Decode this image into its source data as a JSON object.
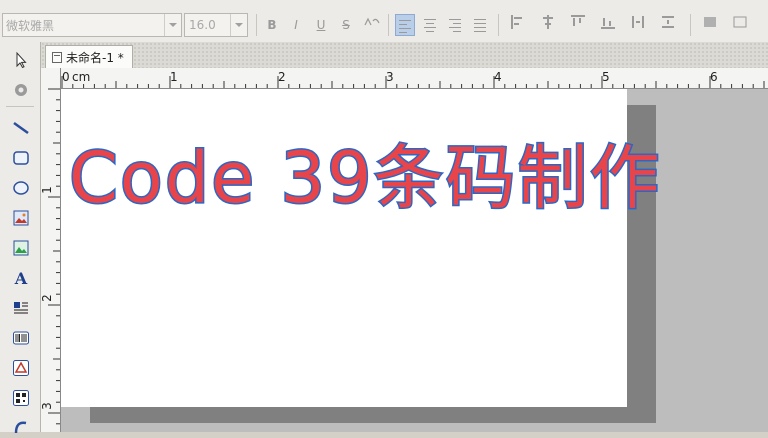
{
  "toolbar": {
    "font_name": "微软雅黑",
    "font_size": "16.0",
    "bold_label": "B",
    "italic_label": "I",
    "underline_label": "U",
    "strike_label": "S"
  },
  "sidebar": {
    "tools": [
      {
        "name": "select-tool",
        "icon": "arrow-pointer-icon"
      },
      {
        "name": "pan-tool",
        "icon": "hand-icon"
      },
      {
        "name": "line-tool",
        "icon": "line-icon"
      },
      {
        "name": "rect-tool",
        "icon": "rounded-rect-icon"
      },
      {
        "name": "ellipse-tool",
        "icon": "ellipse-icon"
      },
      {
        "name": "image-tool",
        "icon": "picture-icon"
      },
      {
        "name": "image-green-tool",
        "icon": "landscape-icon"
      },
      {
        "name": "text-tool",
        "icon": "letter-a-icon",
        "glyph": "A"
      },
      {
        "name": "richtext-tool",
        "icon": "rich-text-icon"
      },
      {
        "name": "barcode-tool",
        "icon": "barcode-icon"
      },
      {
        "name": "shape-tool",
        "icon": "triangle-icon"
      },
      {
        "name": "qrcode-tool",
        "icon": "qr-code-icon"
      },
      {
        "name": "curve-tool",
        "icon": "curve-icon"
      }
    ]
  },
  "document": {
    "tab_title": "未命名-1 *"
  },
  "ruler": {
    "unit": "cm",
    "h_labels": [
      "0",
      "1",
      "2",
      "3",
      "4",
      "5",
      "6"
    ],
    "v_labels": [
      "1",
      "2",
      "3"
    ]
  },
  "canvas": {
    "text": "Code 39条码制作",
    "text_color": "#e8454a",
    "outline_color": "#2a67c6"
  },
  "colors": {
    "accent": "#b9cfe9",
    "workspace": "#bdbdbd",
    "paper": "#ffffff"
  }
}
